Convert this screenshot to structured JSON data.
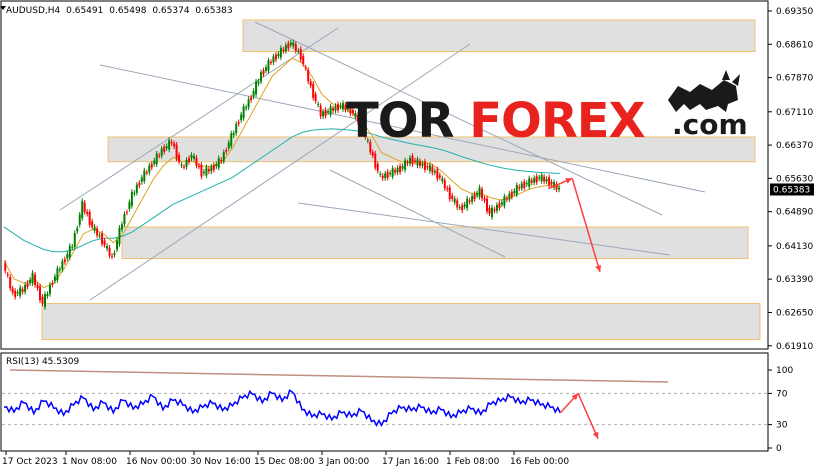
{
  "header": {
    "symbol": "AUDUSD,H4",
    "open": "0.65491",
    "high": "0.65498",
    "low": "0.65374",
    "close": "0.65383"
  },
  "logo": {
    "part1": "TOR",
    "part2": "FOREX",
    "part3": ".com"
  },
  "rsi": {
    "label": "RSI(13) 45.5309"
  },
  "colors": {
    "price_line": "#0000ff",
    "candle_up": "#008000",
    "candle_down": "#ff0000",
    "ma_fast": "#daa520",
    "ma_slow": "#20b2aa",
    "zone_fill": "#e0e0e0",
    "zone_border": "#f0c070",
    "forecast": "#ff4040",
    "trendline": "#9aa8b8",
    "logo_dark": "#1a1a1a",
    "logo_red": "#e8231d"
  },
  "chart_data": {
    "type": "line",
    "title": "AUDUSD,H4",
    "price_axis": {
      "ticks": [
        "0.69350",
        "0.68610",
        "0.67870",
        "0.67110",
        "0.66370",
        "0.65630",
        "0.64890",
        "0.64130",
        "0.63390",
        "0.62650",
        "0.61910"
      ],
      "range": [
        0.6186,
        0.6955
      ]
    },
    "current_price": "0.65383",
    "time_axis": {
      "ticks": [
        "17 Oct 2023",
        "1 Nov 08:00",
        "16 Nov 00:00",
        "30 Nov 16:00",
        "15 Dec 08:00",
        "3 Jan 00:00",
        "17 Jan 16:00",
        "1 Feb 08:00",
        "16 Feb 00:00"
      ]
    },
    "series": [
      {
        "x": [
          0,
          10,
          20,
          30,
          40,
          50,
          60,
          70,
          80,
          90,
          100,
          110,
          120,
          130,
          140,
          150,
          160,
          170,
          180,
          190,
          200,
          210,
          220,
          230,
          240,
          250,
          260,
          270,
          280,
          290,
          300,
          310,
          320,
          330,
          340,
          350,
          360,
          370,
          380,
          390,
          400,
          410,
          420,
          430,
          440,
          450,
          460,
          470,
          480,
          490,
          500,
          510,
          520,
          530,
          540,
          550,
          560
        ],
        "values": [
          0.6375,
          0.6305,
          0.6315,
          0.6345,
          0.6285,
          0.6335,
          0.6375,
          0.6415,
          0.6505,
          0.6455,
          0.6425,
          0.6385,
          0.6465,
          0.6525,
          0.6565,
          0.6595,
          0.6625,
          0.6645,
          0.6585,
          0.6615,
          0.6575,
          0.6585,
          0.6605,
          0.6655,
          0.6705,
          0.6745,
          0.6795,
          0.6825,
          0.6845,
          0.6865,
          0.6835,
          0.6765,
          0.6705,
          0.6715,
          0.6725,
          0.6715,
          0.6685,
          0.6625,
          0.6565,
          0.6575,
          0.6585,
          0.6605,
          0.6595,
          0.6585,
          0.6565,
          0.6525,
          0.6495,
          0.6515,
          0.6535,
          0.6485,
          0.6505,
          0.6525,
          0.6545,
          0.6555,
          0.6565,
          0.6555,
          0.6538
        ]
      }
    ],
    "ma_fast": [
      0.638,
      0.634,
      0.633,
      0.634,
      0.632,
      0.633,
      0.636,
      0.64,
      0.644,
      0.645,
      0.644,
      0.642,
      0.644,
      0.648,
      0.652,
      0.656,
      0.659,
      0.661,
      0.66,
      0.66,
      0.659,
      0.659,
      0.66,
      0.663,
      0.667,
      0.671,
      0.675,
      0.679,
      0.681,
      0.683,
      0.682,
      0.679,
      0.675,
      0.673,
      0.672,
      0.671,
      0.669,
      0.666,
      0.662,
      0.661,
      0.66,
      0.66,
      0.66,
      0.6595,
      0.658,
      0.656,
      0.654,
      0.653,
      0.653,
      0.652,
      0.6515,
      0.652,
      0.653,
      0.654,
      0.6545,
      0.6548,
      0.6545
    ],
    "ma_slow": [
      0.6455,
      0.644,
      0.6425,
      0.6415,
      0.6405,
      0.64,
      0.64,
      0.6405,
      0.6415,
      0.6425,
      0.643,
      0.643,
      0.6435,
      0.6445,
      0.646,
      0.6475,
      0.649,
      0.6505,
      0.6515,
      0.6525,
      0.6535,
      0.6545,
      0.6555,
      0.6565,
      0.658,
      0.6595,
      0.661,
      0.6625,
      0.664,
      0.6655,
      0.6665,
      0.667,
      0.6672,
      0.6673,
      0.6672,
      0.667,
      0.6667,
      0.6662,
      0.6655,
      0.665,
      0.6645,
      0.664,
      0.6636,
      0.6632,
      0.6627,
      0.662,
      0.6612,
      0.6605,
      0.6598,
      0.6592,
      0.6587,
      0.6583,
      0.658,
      0.6578,
      0.6576,
      0.6575,
      0.6574
    ],
    "zones": [
      {
        "from": 0.6845,
        "to": 0.6915
      },
      {
        "from": 0.66,
        "to": 0.6655
      },
      {
        "from": 0.6385,
        "to": 0.6455
      },
      {
        "from": 0.6205,
        "to": 0.6285
      }
    ],
    "forecast": [
      {
        "from_x": 548,
        "from_y": 0.654,
        "to_x": 572,
        "to_y": 0.6563
      },
      {
        "from_x": 572,
        "from_y": 0.6563,
        "to_x": 600,
        "to_y": 0.6355
      }
    ],
    "rsi_panel": {
      "ticks": [
        "100",
        "70",
        "30",
        "0"
      ],
      "range": [
        0,
        100
      ],
      "values": [
        52,
        46,
        58,
        44,
        60,
        51,
        42,
        55,
        64,
        48,
        58,
        45,
        61,
        50,
        56,
        66,
        49,
        61,
        55,
        45,
        52,
        57,
        48,
        54,
        64,
        69,
        58,
        70,
        60,
        72,
        49,
        40,
        43,
        36,
        45,
        40,
        47,
        34,
        29,
        44,
        51,
        48,
        52,
        44,
        49,
        39,
        45,
        50,
        43,
        56,
        60,
        65,
        57,
        61,
        55,
        52,
        45
      ],
      "forecast": [
        {
          "from_x": 560,
          "from_y": 45,
          "to_x": 578,
          "to_y": 70
        },
        {
          "from_x": 578,
          "from_y": 70,
          "to_x": 598,
          "to_y": 12
        }
      ]
    }
  }
}
